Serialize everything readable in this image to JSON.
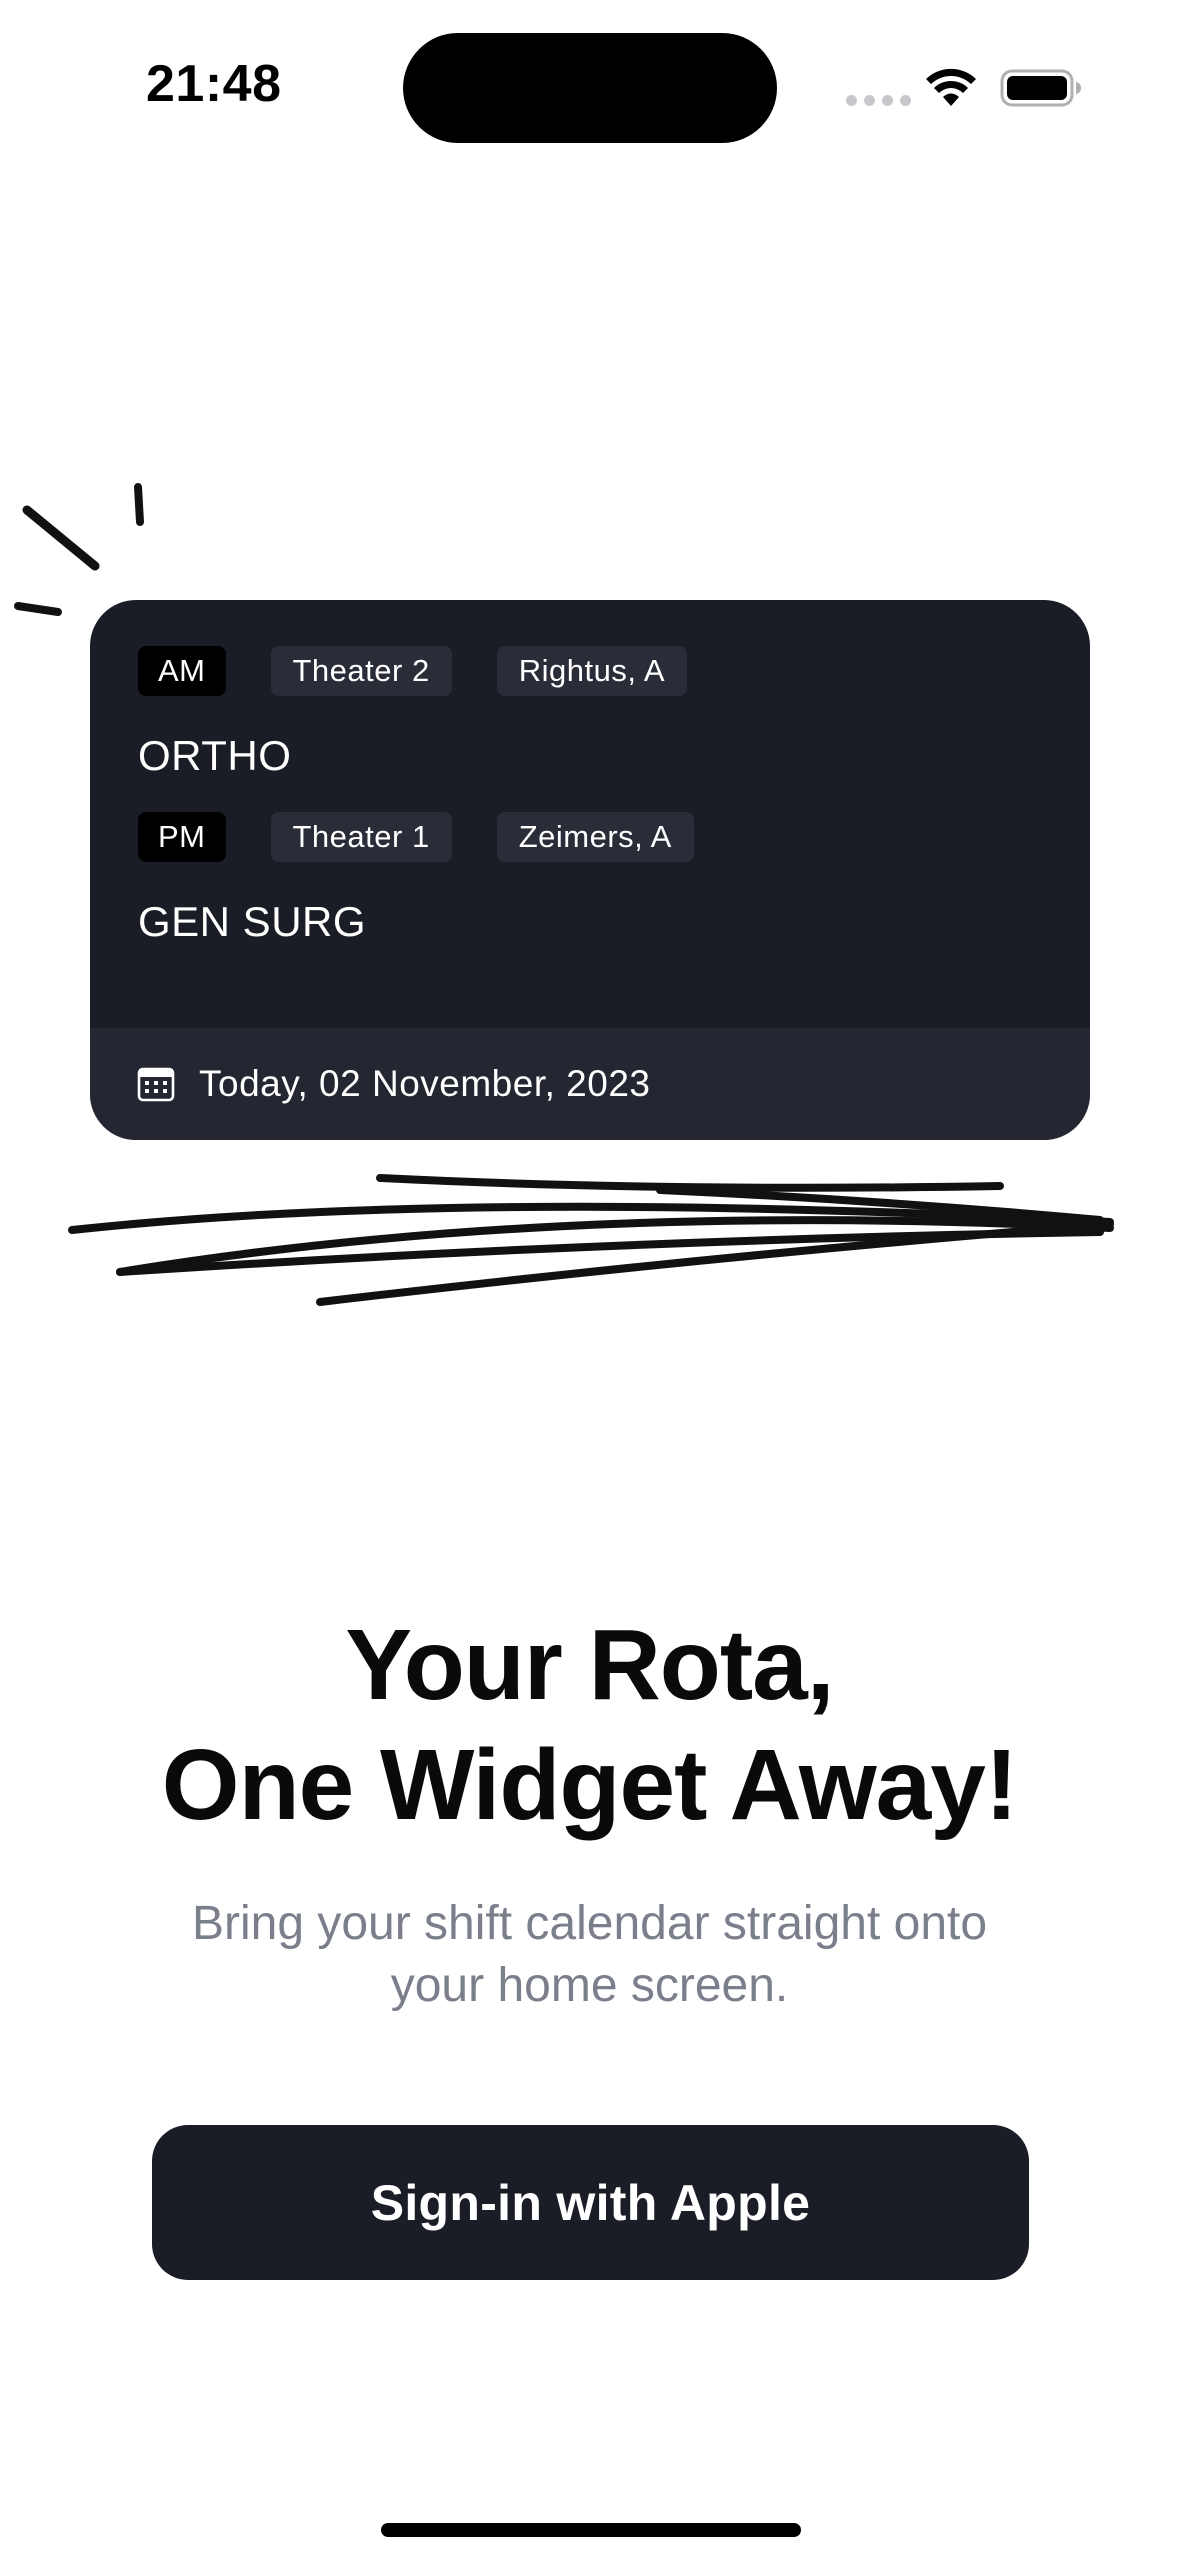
{
  "status_bar": {
    "time": "21:48",
    "icons": [
      "cellular-signal-icon",
      "wifi-icon",
      "battery-icon"
    ]
  },
  "widget": {
    "shifts": [
      {
        "period": "AM",
        "location": "Theater 2",
        "person": "Rightus, A",
        "specialty": "ORTHO"
      },
      {
        "period": "PM",
        "location": "Theater 1",
        "person": "Zeimers, A",
        "specialty": "GEN SURG"
      }
    ],
    "date_label": "Today, 02 November, 2023",
    "date_icon": "calendar-icon"
  },
  "headline": {
    "line1": "Your Rota,",
    "line2": "One Widget Away!"
  },
  "subtitle": {
    "line1": "Bring your shift calendar straight onto",
    "line2": "your home screen."
  },
  "signin_button": {
    "label": "Sign-in with Apple"
  },
  "colors": {
    "widget_bg": "#1b1d26",
    "widget_footer_bg": "#242732",
    "chip_bg": "#2a2d38",
    "button_bg": "#1b1d26",
    "subtitle": "#7b7f8c"
  }
}
